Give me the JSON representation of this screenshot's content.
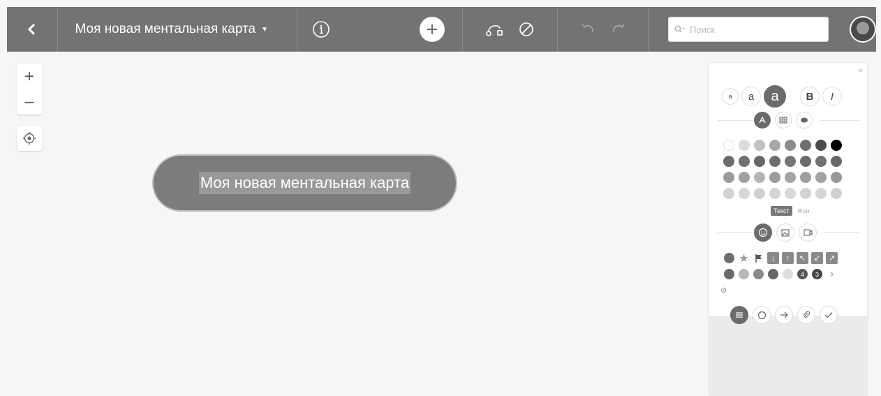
{
  "toolbar": {
    "back_icon": "chevron-left-icon",
    "map_title": "Моя новая ментальная карта",
    "search_placeholder": "Поиск"
  },
  "canvas": {
    "zoom_in": "+",
    "zoom_out": "–",
    "central_node_text": "Моя новая ментальная карта"
  },
  "panel": {
    "close": "×",
    "font_sizes": [
      "a",
      "a",
      "a"
    ],
    "bold": "B",
    "italic": "I",
    "color_tabs": [
      "Текст",
      "Фон"
    ],
    "colors": [
      [
        "#ffffff",
        "#dcdcdc",
        "#c2c2c2",
        "#a8a8a8",
        "#8c8c8c",
        "#6e6e6e",
        "#4c4c4c",
        "#000000"
      ],
      [
        "#6b6b6b",
        "#707070",
        "#666666",
        "#6e6e6e",
        "#747474",
        "#6a6a6a",
        "#707070",
        "#686868"
      ],
      [
        "#9a9a9a",
        "#a0a0a0",
        "#b4b4b4",
        "#9c9c9c",
        "#a4a4a4",
        "#9e9e9e",
        "#a2a2a2",
        "#989898"
      ],
      [
        "#d2d2d2",
        "#d6d6d6",
        "#d0d0d0",
        "#d4d4d4",
        "#d8d8d8",
        "#d2d2d2",
        "#d6d6d6",
        "#d0d0d0"
      ]
    ],
    "badge_4": "4",
    "badge_3": "3",
    "more": "›",
    "none": "⊘"
  }
}
